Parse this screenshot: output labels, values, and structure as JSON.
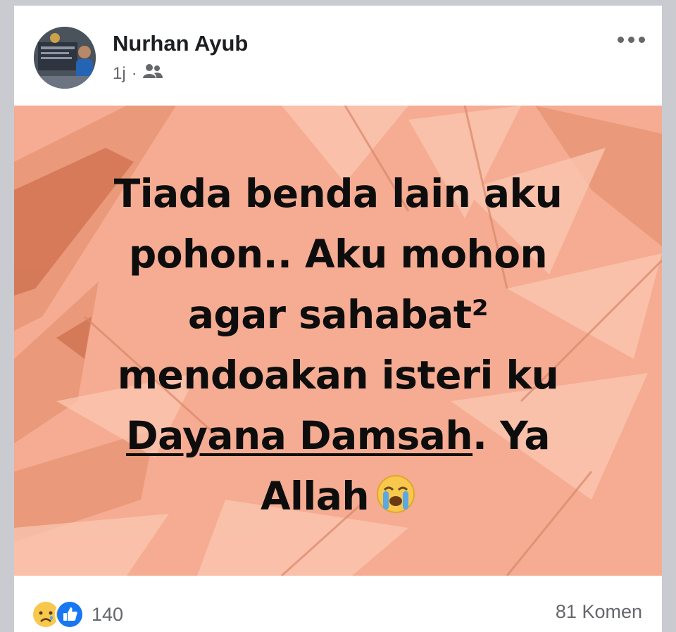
{
  "post": {
    "author": "Nurhan Ayub",
    "time": "1j",
    "separator": "·",
    "audience_icon": "friends-icon",
    "more_icon": "more-options-icon",
    "text": {
      "line1": "Tiada benda lain aku",
      "line2": "pohon.. Aku mohon",
      "line3": "agar sahabat²",
      "line4": "mendoakan isteri ku",
      "line5_link": "Dayana Damsah",
      "line5_rest": ". Ya",
      "line6": "Allah"
    },
    "background_color": "#f5ac92",
    "emoji": "loudly-crying-face"
  },
  "footer": {
    "reaction_icons": [
      "sad-reaction-icon",
      "like-reaction-icon"
    ],
    "reaction_count": "140",
    "comments": "81 Komen"
  },
  "colors": {
    "like_blue": "#1877f2",
    "sad_yellow": "#f7c84d",
    "muted_text": "#65676b"
  }
}
